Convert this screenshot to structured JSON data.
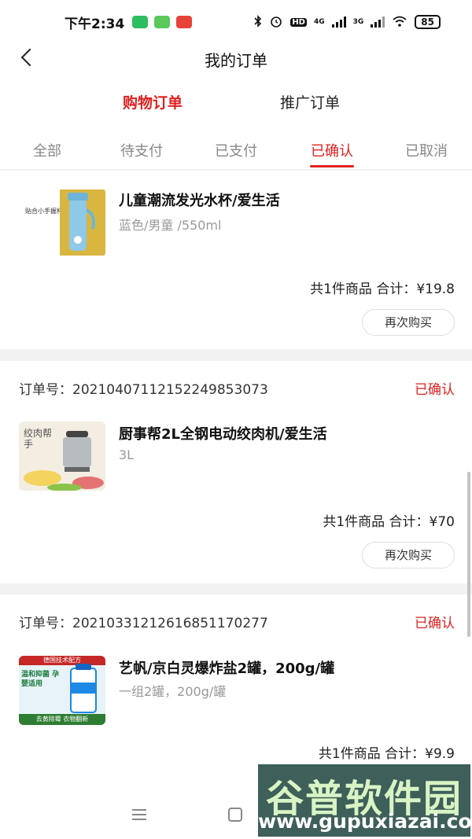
{
  "status_bar": {
    "time": "下午2:34",
    "app_icons": [
      "wechat-icon",
      "message-app-icon",
      "shopping-app-icon"
    ],
    "net1": "4G",
    "net2": "3G",
    "battery": "85"
  },
  "header": {
    "title": "我的订单"
  },
  "top_tabs": [
    "购物订单",
    "推广订单"
  ],
  "status_tabs": [
    "全部",
    "待支付",
    "已支付",
    "已确认",
    "已取消"
  ],
  "orders": [
    {
      "product_name": "儿童潮流发光水杯/爱生活",
      "spec": "蓝色/男童 /550ml",
      "thumb_text": "贴合小手握杯",
      "total": "共1件商品 合计：¥19.8",
      "button": "再次购买"
    },
    {
      "order_label": "订单号：20210407112152249853073",
      "status": "已确认",
      "product_name": "厨事帮2L全钢电动绞肉机/爱生活",
      "spec": "3L",
      "thumb_text": "绞肉帮手",
      "total": "共1件商品 合计：¥70",
      "button": "再次购买"
    },
    {
      "order_label": "订单号：20210331212616851170277",
      "status": "已确认",
      "product_name": "艺帆/京白灵爆炸盐2罐，200g/罐",
      "spec": "一组2罐，200g/罐",
      "thumb_top": "德国技术配方",
      "thumb_mid": "温和抑菌 孕婴适用",
      "thumb_bottom": "去黄除霉 衣物翻新",
      "total": "共1件商品 合计：¥9.9"
    }
  ],
  "watermark": {
    "name": "谷普软件园",
    "url": "www.gupuxiazai.com"
  },
  "colors": {
    "accent": "#e02020",
    "background": "#f2f2f2"
  }
}
